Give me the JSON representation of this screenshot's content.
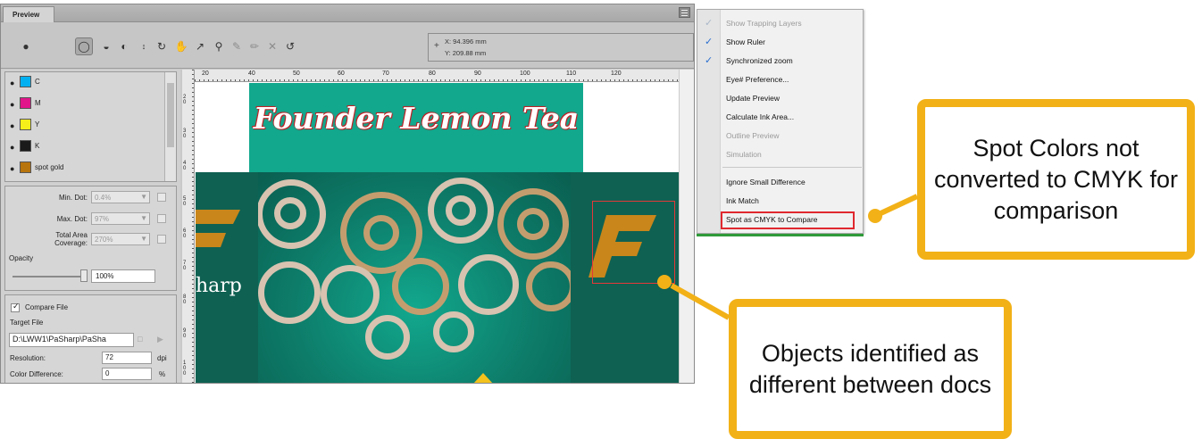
{
  "window": {
    "tab_label": "Preview",
    "coords": {
      "x": "X: 94.396 mm",
      "y": "Y: 209.88 mm"
    }
  },
  "toolbar": {
    "icons": [
      "eye-icon",
      "circle-gray-icon",
      "half-circle-icon",
      "half-circle-outline-icon",
      "overprint-icon",
      "separation-icon",
      "hand-icon",
      "pointer-icon",
      "zoom-icon",
      "brush-icon",
      "eraser-icon",
      "cross-icon",
      "arrow-icon"
    ]
  },
  "inks": [
    {
      "name": "C",
      "color": "#00b0f0"
    },
    {
      "name": "M",
      "color": "#e0168a"
    },
    {
      "name": "Y",
      "color": "#f7ef1a"
    },
    {
      "name": "K",
      "color": "#1a1a1a"
    },
    {
      "name": "spot gold",
      "color": "#b8740d"
    }
  ],
  "dots": {
    "min_dot_label": "Min. Dot:",
    "min_dot_value": "0.4%",
    "max_dot_label": "Max. Dot:",
    "max_dot_value": "97%",
    "tac_label_1": "Total Area",
    "tac_label_2": "Coverage:",
    "tac_value": "270%",
    "opacity_label": "Opacity",
    "opacity_value": "100%"
  },
  "compare": {
    "compare_label": "Compare File",
    "target_label": "Target File",
    "target_path": "D:\\LWW1\\PaSharp\\PaSha",
    "resolution_label": "Resolution:",
    "resolution_value": "72",
    "resolution_unit": "dpi",
    "color_diff_label": "Color Difference:",
    "color_diff_value": "0",
    "color_diff_unit": "%"
  },
  "rulers": {
    "h_ticks": [
      "20",
      "40",
      "50",
      "60",
      "70",
      "80",
      "90",
      "100",
      "110",
      "120"
    ],
    "v_ticks": [
      "20",
      "30",
      "40",
      "50",
      "60",
      "70",
      "80",
      "90",
      "100"
    ]
  },
  "artwork": {
    "title": "Founder Lemon Tea",
    "brand_text": "harp",
    "colors": {
      "teal": "#12a88e",
      "dark_teal": "#0f6152",
      "gold": "#c8861b",
      "highlight": "#e43838"
    }
  },
  "menu": {
    "items": [
      {
        "label": "Show Trapping Layers",
        "checked": true,
        "enabled": false
      },
      {
        "label": "Show Ruler",
        "checked": true,
        "enabled": true
      },
      {
        "label": "Synchronized zoom",
        "checked": true,
        "enabled": true
      },
      {
        "label": "Eye# Preference...",
        "checked": false,
        "enabled": true
      },
      {
        "label": "Update Preview",
        "checked": false,
        "enabled": true
      },
      {
        "label": "Calculate Ink Area...",
        "checked": false,
        "enabled": true
      },
      {
        "label": "Outline Preview",
        "checked": false,
        "enabled": false
      },
      {
        "label": "Simulation",
        "checked": false,
        "enabled": false
      },
      {
        "label": "Ignore Small Difference",
        "checked": false,
        "enabled": true
      },
      {
        "label": "Ink Match",
        "checked": false,
        "enabled": true
      },
      {
        "label": "Spot as CMYK to Compare",
        "checked": false,
        "enabled": true
      }
    ]
  },
  "callouts": {
    "spot_colors": "Spot Colors not converted to CMYK for comparison",
    "objects": "Objects identified as different between docs",
    "accent": "#f2b117"
  }
}
